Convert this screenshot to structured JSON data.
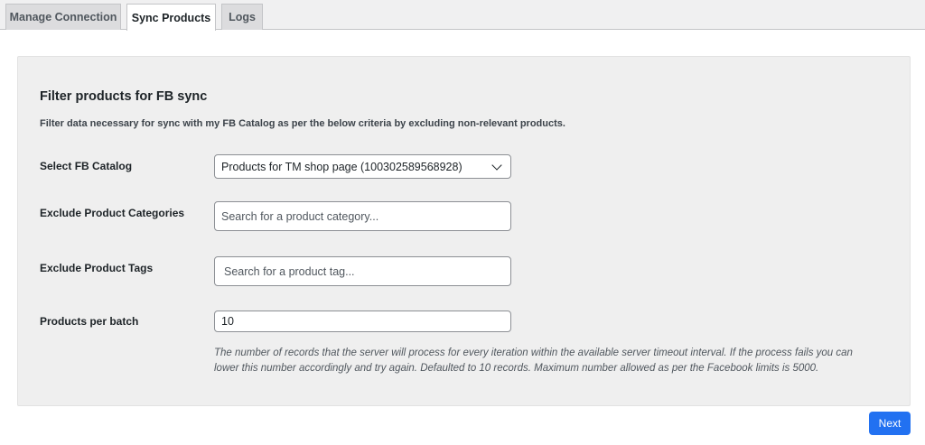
{
  "tabs": [
    {
      "label": "Manage Connection",
      "active": false
    },
    {
      "label": "Sync Products",
      "active": true
    },
    {
      "label": "Logs",
      "active": false
    }
  ],
  "panel": {
    "heading": "Filter products for FB sync",
    "description": "Filter data necessary for sync with my FB Catalog as per the below criteria by excluding non-relevant products.",
    "fields": {
      "catalog": {
        "label": "Select FB Catalog",
        "value": "Products for TM shop page (100302589568928)"
      },
      "categories": {
        "label": "Exclude Product Categories",
        "placeholder": "Search for a product category..."
      },
      "tags": {
        "label": "Exclude Product Tags",
        "placeholder": "Search for a product tag..."
      },
      "batch": {
        "label": "Products per batch",
        "value": "10"
      }
    },
    "help_text": "The number of records that the server will process for every iteration within the available server timeout interval. If the process fails you can lower this number accordingly and try again. Defaulted to 10 records. Maximum number allowed as per the Facebook limits is 5000."
  },
  "actions": {
    "next_label": "Next"
  },
  "colors": {
    "primary": "#2271f1",
    "panel_bg": "#efefef",
    "tabbar_bg": "#f0f0f1"
  }
}
